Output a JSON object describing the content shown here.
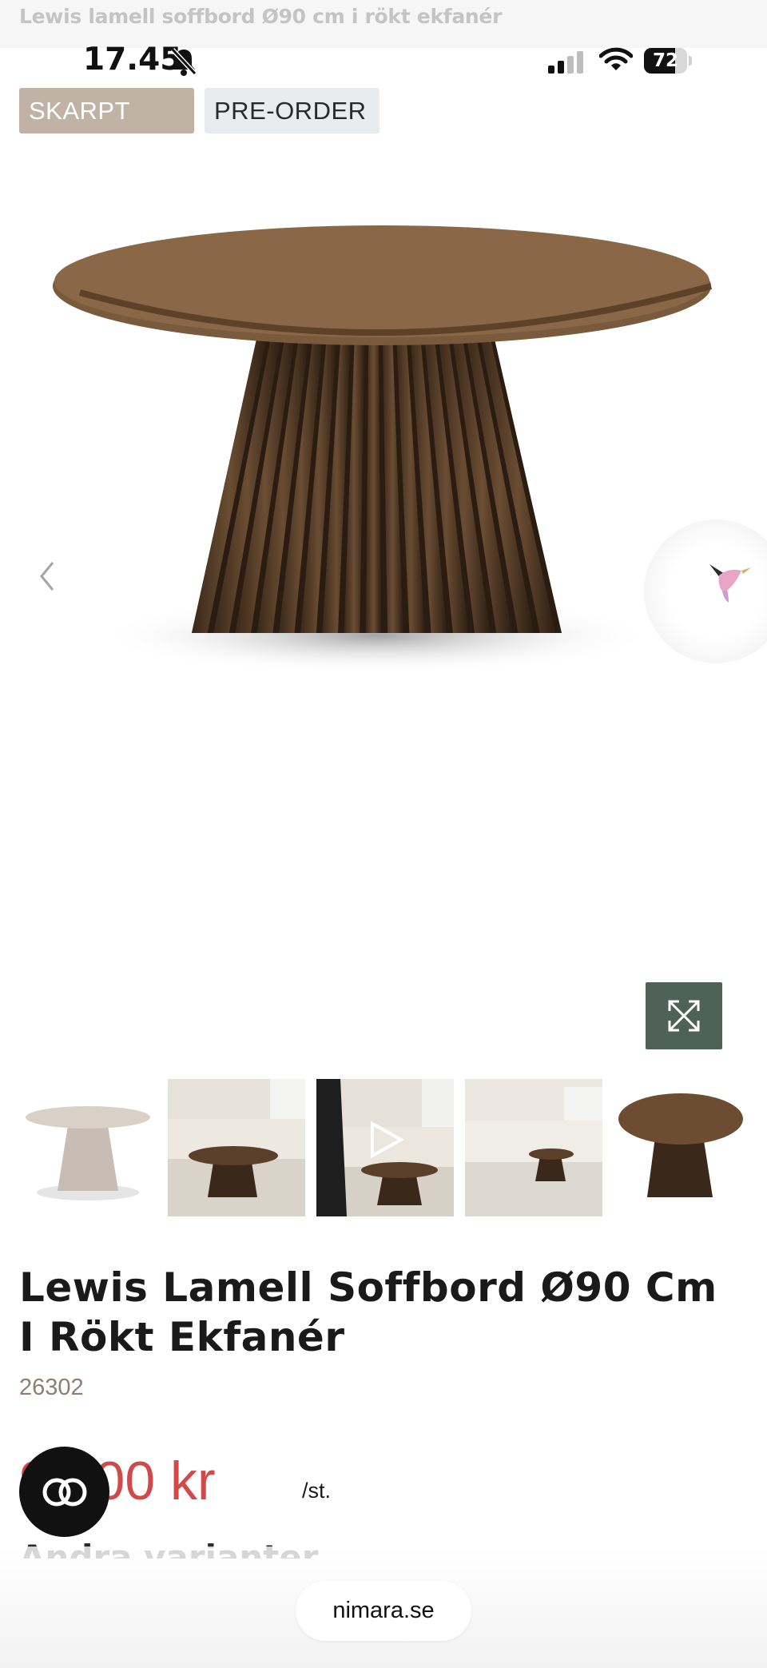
{
  "header": {
    "page_title": "Lewis lamell soffbord Ø90 cm i rökt ekfanér"
  },
  "status_bar": {
    "time": "17.45",
    "battery": "72",
    "battery_level": 0.72,
    "icons": [
      "bell-slash-icon",
      "signal-icon",
      "wifi-icon",
      "battery-icon"
    ]
  },
  "badges": {
    "price_badge": "SKARPT PRIS",
    "preorder_badge": "PRE-ORDER"
  },
  "gallery": {
    "icons": [
      "chevron-left-icon",
      "expand-icon",
      "play-icon",
      "chat-bird-icon"
    ]
  },
  "product": {
    "title": "Lewis Lamell Soffbord Ø90 Cm I Rökt Ekfanér",
    "sku": "26302",
    "price": "99,00 kr",
    "price_unit": "/st."
  },
  "section": {
    "other_variants": "Andra varianter"
  },
  "browser": {
    "url": "nimara.se"
  },
  "colors": {
    "price": "#d14a4a",
    "accent_green": "#4e6257",
    "price_badge_bg": "#c0b2a5",
    "preorder_badge_bg": "#e9ecee"
  }
}
